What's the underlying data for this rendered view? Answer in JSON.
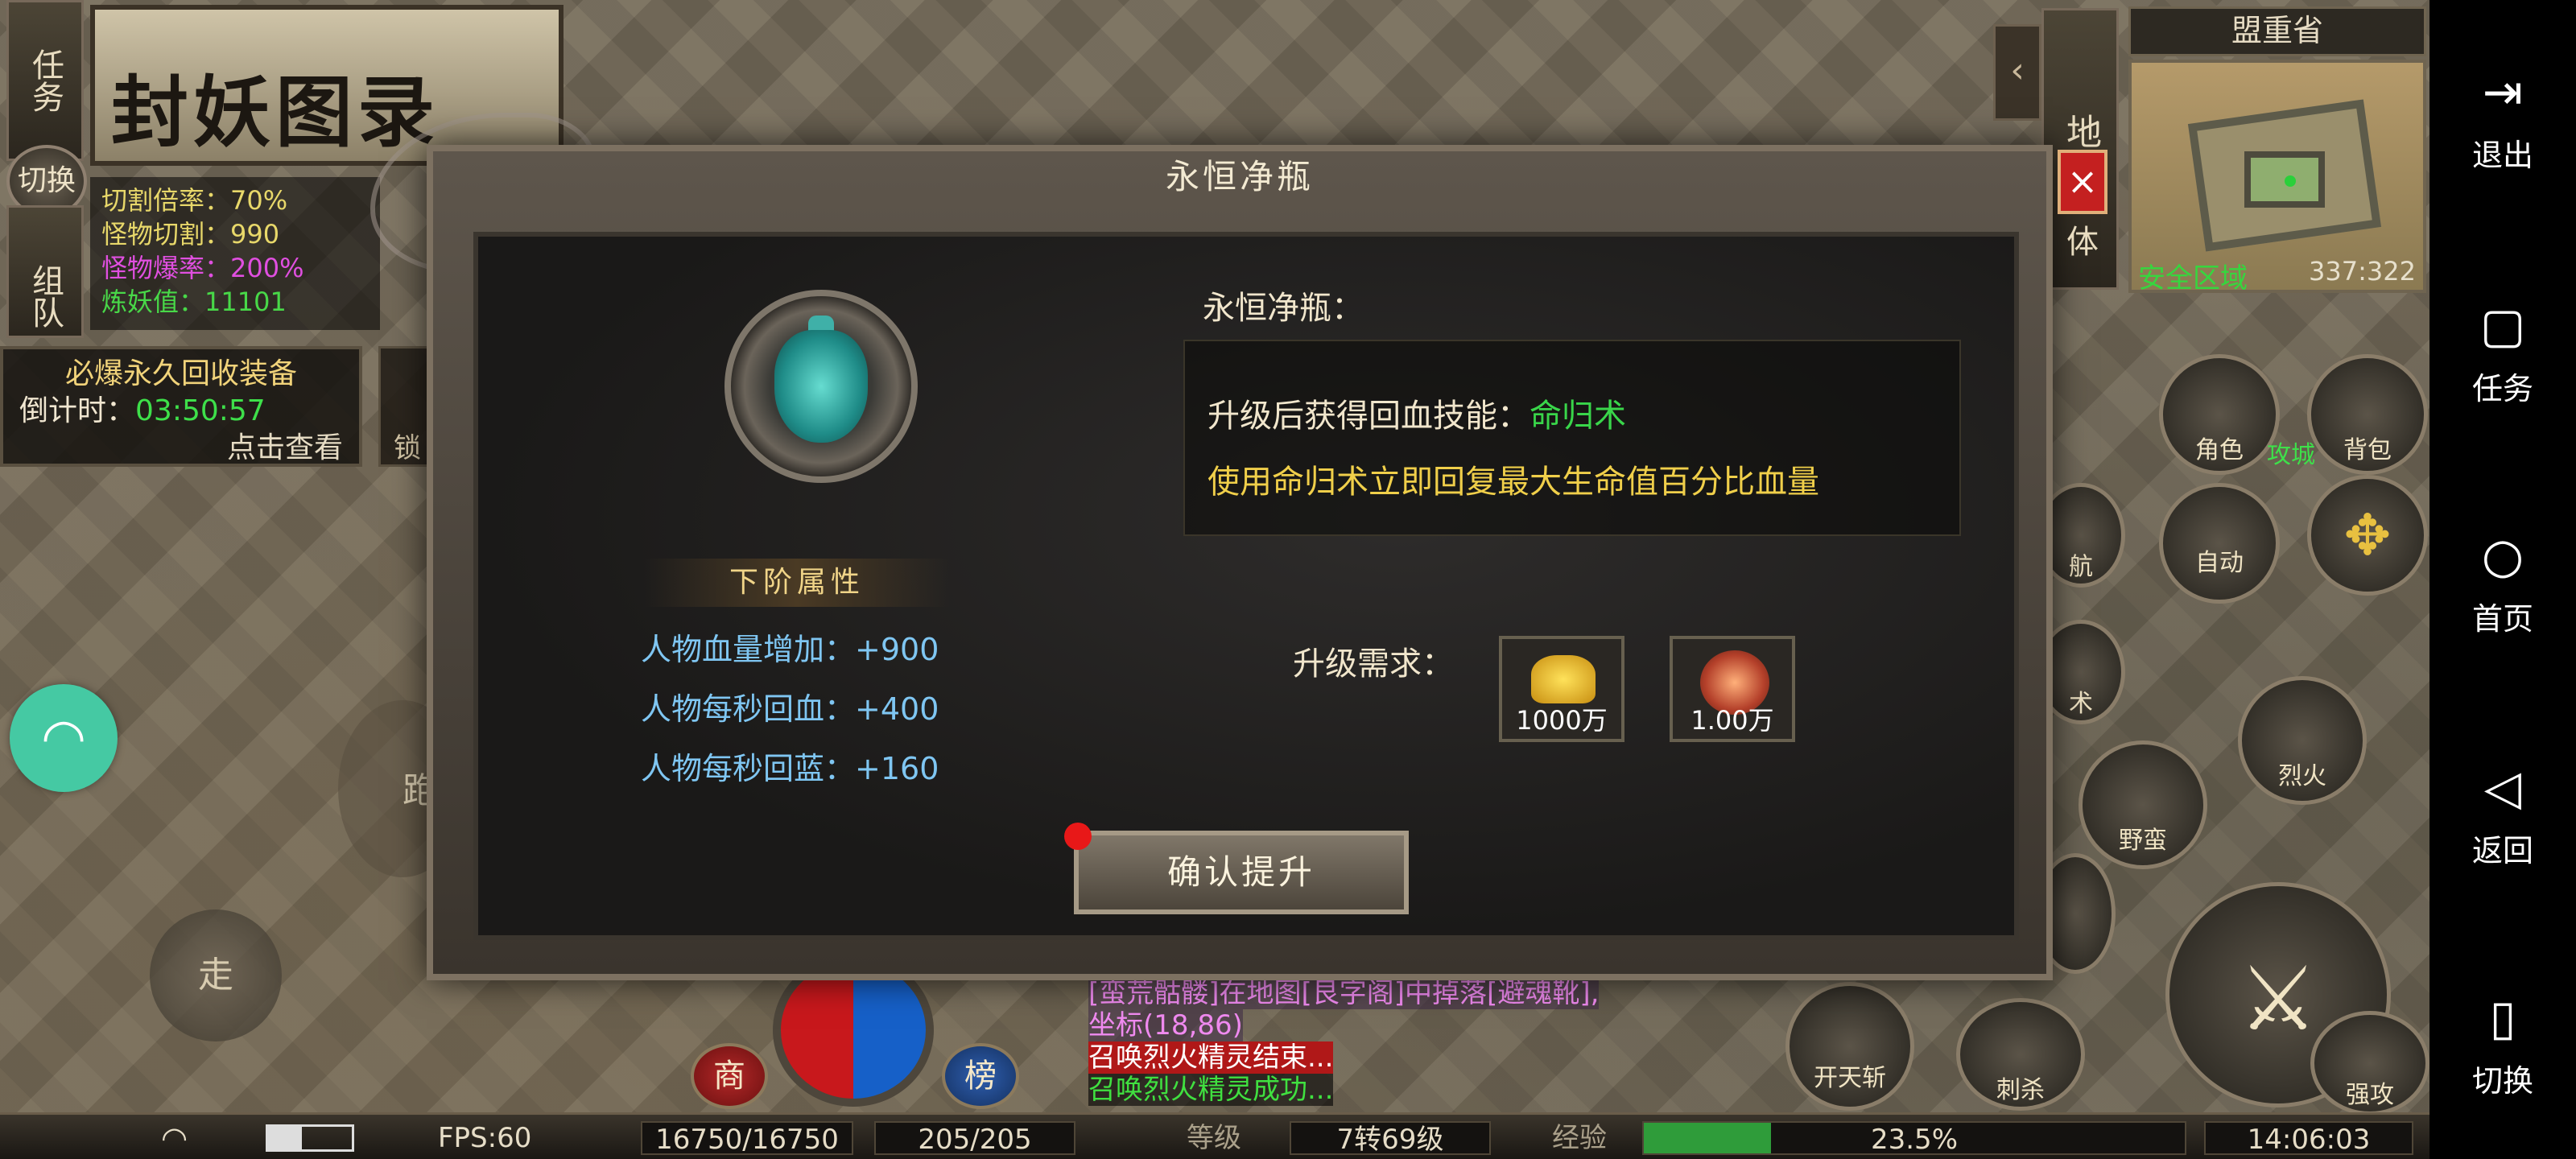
{
  "left_panel": {
    "task_tab": "任务",
    "switch_btn": "切换",
    "team_tab": "组队",
    "logo_title": "封妖图录",
    "stats": [
      {
        "label": "切割倍率：",
        "value": "70%",
        "color": "#e8d86a"
      },
      {
        "label": "怪物切割：",
        "value": "990",
        "color": "#e8d86a"
      },
      {
        "label": "怪物爆率：",
        "value": "200%",
        "color": "#e04fe0"
      },
      {
        "label": "炼妖值：",
        "value": "11101",
        "color": "#48d848"
      }
    ],
    "recycle_title": "必爆永久回收装备",
    "countdown_label": "倒计时：",
    "countdown_value": "03:50:57",
    "click_view": "点击查看",
    "side_lock": "锁"
  },
  "top_right": {
    "map_tab": "地图",
    "body_tab": "体",
    "region": "盟重省",
    "safe_zone": "安全区域",
    "coords": "337:322"
  },
  "right_buttons": {
    "role": "角色",
    "bag": "背包",
    "attack_city": "攻城",
    "auto": "自动",
    "guide_partial": "航",
    "skill_partial": "术",
    "fire": "烈火",
    "wild": "野蛮",
    "open_sky": "开天斩",
    "stab": "刺杀",
    "strong_attack": "强攻"
  },
  "controls": {
    "walk": "走",
    "run_partial": "跑",
    "shop": "商",
    "rank": "榜"
  },
  "chat": {
    "line1": "[蛮荒骷髅]在地图[艮字阁]中掉落[避魂靴],",
    "line2": "坐标(18,86)",
    "line3": "召唤烈火精灵结束...",
    "line4": "召唤烈火精灵成功..."
  },
  "status_bar": {
    "fps": "FPS:60",
    "hp": "16750/16750",
    "mp": "205/205",
    "level_label": "等级",
    "level_value": "7转69级",
    "exp_label": "经验",
    "exp_value": "23.5%",
    "exp_fraction": 0.235,
    "time": "14:06:03"
  },
  "dialog": {
    "title": "永恒净瓶",
    "item_name": "永恒净瓶：",
    "skill_line_prefix": "升级后获得回血技能：",
    "skill_name": "命归术",
    "skill_desc": "使用命归术立即回复最大生命值百分比血量",
    "next_attr_header": "下阶属性",
    "attrs": [
      "人物血量增加：+900",
      "人物每秒回血：+400",
      "人物每秒回蓝：+160"
    ],
    "req_label": "升级需求：",
    "req_items": [
      {
        "qty": "1000万",
        "icon": "gold-ingot"
      },
      {
        "qty": "1.00万",
        "icon": "fire-stone"
      }
    ],
    "confirm": "确认提升",
    "close": "×"
  },
  "system_nav": {
    "exit": "退出",
    "task": "任务",
    "home": "首页",
    "back": "返回",
    "switch": "切换"
  },
  "colors": {
    "skill_green": "#39d64a",
    "desc_yellow": "#f0cf4a",
    "attr_blue": "#7fc6f2"
  }
}
